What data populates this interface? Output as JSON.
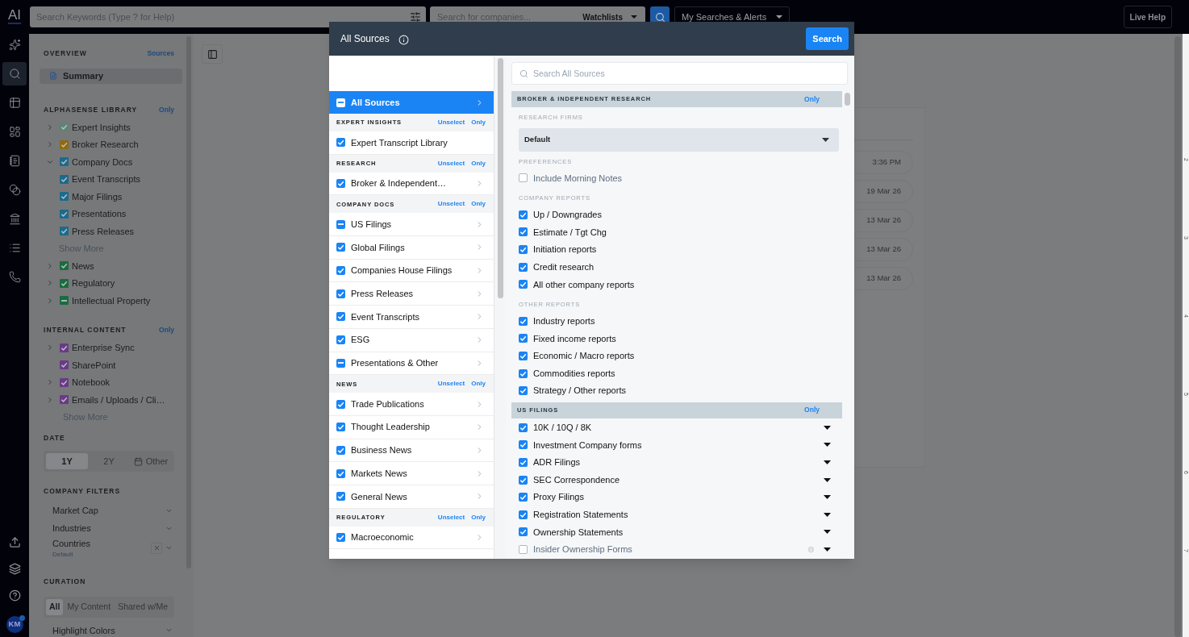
{
  "rail": {
    "logo": "AI",
    "items": [
      {
        "selected": false
      },
      {
        "selected": true
      },
      {
        "selected": false
      },
      {
        "selected": false
      },
      {
        "selected": false
      },
      {
        "selected": false
      },
      {
        "selected": false
      },
      {
        "selected": false
      },
      {
        "selected": false
      }
    ],
    "avatar": {
      "initials": "KM",
      "notification": true
    }
  },
  "top_bar": {
    "keyword_search": {
      "placeholder": "Search Keywords (Type ? for Help)"
    },
    "company_search": {
      "placeholder": "Search for companies..."
    },
    "watchlists": "Watchlists",
    "saved_searches": "My Searches & Alerts",
    "live_help": "Live Help"
  },
  "sidebar": {
    "overview": {
      "title": "OVERVIEW",
      "link": "Sources",
      "items": [
        {
          "label": "Summary",
          "selected": true
        }
      ]
    },
    "sections": [
      {
        "title": "ALPHASENSE LIBRARY",
        "action": "Only",
        "items": [
          {
            "label": "Expert Insights",
            "color": "#5f8273",
            "checked": true,
            "expanded": false
          },
          {
            "label": "Broker Research",
            "color": "#8c6b12",
            "checked": true,
            "expanded": false
          },
          {
            "label": "Company Docs",
            "color": "#1c6a8c",
            "checked": true,
            "expanded": true,
            "children": [
              {
                "label": "Event Transcripts",
                "color": "#1c6a8c",
                "checked": true
              },
              {
                "label": "Major Filings",
                "color": "#1c6a8c",
                "checked": true
              },
              {
                "label": "Presentations",
                "color": "#1c6a8c",
                "checked": true
              },
              {
                "label": "Press Releases",
                "color": "#1c6a8c",
                "checked": true
              }
            ],
            "show_more": "Show More"
          },
          {
            "label": "News",
            "color": "#1b6b3e",
            "checked": true,
            "expanded": false
          },
          {
            "label": "Regulatory",
            "color": "#1b6b3e",
            "checked": true,
            "expanded": false
          },
          {
            "label": "Intellectual Property",
            "color": "#1b6b3e",
            "checked": true,
            "partial": true,
            "expanded": false
          }
        ]
      },
      {
        "title": "INTERNAL CONTENT",
        "action": "Only",
        "items": [
          {
            "label": "Enterprise Sync",
            "color": "#6a3a88",
            "checked": true,
            "expanded": false
          },
          {
            "label": "SharePoint",
            "color": "#6a3a88",
            "checked": true
          },
          {
            "label": "Notebook",
            "color": "#6a3a88",
            "checked": true,
            "expanded": false
          },
          {
            "label": "Emails / Uploads / Cli…",
            "color": "#6a3a88",
            "checked": true,
            "expanded": false
          }
        ],
        "show_more": "Show More"
      }
    ],
    "date": {
      "title": "DATE",
      "options": [
        {
          "label": "1Y",
          "selected": true,
          "kind": "plain"
        },
        {
          "label": "2Y",
          "selected": false,
          "kind": "plain"
        },
        {
          "label": "Other",
          "selected": false,
          "kind": "calendar"
        }
      ]
    },
    "company_filters": {
      "title": "COMPANY FILTERS",
      "items": [
        {
          "label": "Market Cap",
          "clearable": false
        },
        {
          "label": "Industries",
          "clearable": false
        },
        {
          "label": "Countries",
          "note": "Default",
          "clearable": true
        }
      ]
    },
    "curation": {
      "title": "CURATION",
      "tabs": [
        {
          "label": "All",
          "selected": true
        },
        {
          "label": "My Content",
          "selected": false
        },
        {
          "label": "Shared w/Me",
          "selected": false
        }
      ],
      "next_filter": "Highlight Colors"
    }
  },
  "main": {
    "dates": [
      "3:36 PM",
      "19 Mar 26",
      "13 Mar 26",
      "13 Mar 26",
      "13 Mar 26"
    ]
  },
  "ruler": [
    "2",
    "3",
    "4",
    "5",
    "6",
    "7"
  ],
  "modal": {
    "title": "All Sources",
    "search_button": "Search",
    "root": {
      "label": "All Sources",
      "checked": true,
      "partial": true,
      "selected": true
    },
    "groups": [
      {
        "title": "EXPERT INSIGHTS",
        "unselect": "Unselect",
        "only": "Only",
        "items": [
          {
            "label": "Expert Transcript Library",
            "checked": true,
            "arrow": false
          }
        ]
      },
      {
        "title": "RESEARCH",
        "unselect": "Unselect",
        "only": "Only",
        "items": [
          {
            "label": "Broker & Independent…",
            "checked": true,
            "arrow": true
          }
        ]
      },
      {
        "title": "COMPANY DOCS",
        "unselect": "Unselect",
        "only": "Only",
        "items": [
          {
            "label": "US Filings",
            "checked": true,
            "partial": true,
            "arrow": true
          },
          {
            "label": "Global Filings",
            "checked": true,
            "arrow": true
          },
          {
            "label": "Companies House Filings",
            "checked": true,
            "arrow": true
          },
          {
            "label": "Press Releases",
            "checked": true,
            "arrow": true
          },
          {
            "label": "Event Transcripts",
            "checked": true,
            "arrow": true
          },
          {
            "label": "ESG",
            "checked": true,
            "arrow": true
          },
          {
            "label": "Presentations & Other",
            "checked": true,
            "partial": true,
            "arrow": true
          }
        ]
      },
      {
        "title": "NEWS",
        "unselect": "Unselect",
        "only": "Only",
        "items": [
          {
            "label": "Trade Publications",
            "checked": true,
            "arrow": true
          },
          {
            "label": "Thought Leadership",
            "checked": true,
            "arrow": true
          },
          {
            "label": "Business News",
            "checked": true,
            "arrow": true
          },
          {
            "label": "Markets News",
            "checked": true,
            "arrow": true
          },
          {
            "label": "General News",
            "checked": true,
            "arrow": true
          }
        ]
      },
      {
        "title": "REGULATORY",
        "unselect": "Unselect",
        "only": "Only",
        "items": [
          {
            "label": "Macroeconomic",
            "checked": true,
            "arrow": true
          }
        ]
      }
    ],
    "search": {
      "placeholder": "Search All Sources"
    },
    "sections": [
      {
        "title": "BROKER & INDEPENDENT RESEARCH",
        "action": "Only",
        "blocks": [
          {
            "kind": "select",
            "title": "RESEARCH FIRMS",
            "value": "Default"
          },
          {
            "kind": "checks",
            "title": "PREFERENCES",
            "items": [
              {
                "label": "Include Morning Notes",
                "checked": false
              }
            ]
          },
          {
            "kind": "checks",
            "title": "COMPANY REPORTS",
            "items": [
              {
                "label": "Up / Downgrades",
                "checked": true
              },
              {
                "label": "Estimate / Tgt Chg",
                "checked": true
              },
              {
                "label": "Initiation reports",
                "checked": true
              },
              {
                "label": "Credit research",
                "checked": true
              },
              {
                "label": "All other company reports",
                "checked": true
              }
            ]
          },
          {
            "kind": "checks",
            "title": "OTHER REPORTS",
            "items": [
              {
                "label": "Industry reports",
                "checked": true
              },
              {
                "label": "Fixed income reports",
                "checked": true
              },
              {
                "label": "Economic / Macro reports",
                "checked": true
              },
              {
                "label": "Commodities reports",
                "checked": true
              },
              {
                "label": "Strategy / Other reports",
                "checked": true
              }
            ]
          }
        ]
      },
      {
        "title": "US FILINGS",
        "action": "Only",
        "blocks": [
          {
            "kind": "checks",
            "items": [
              {
                "label": "10K / 10Q / 8K",
                "checked": true,
                "menu": true
              },
              {
                "label": "Investment Company forms",
                "checked": true,
                "menu": true
              },
              {
                "label": "ADR Filings",
                "checked": true,
                "menu": true
              },
              {
                "label": "SEC Correspondence",
                "checked": true,
                "menu": true
              },
              {
                "label": "Proxy Filings",
                "checked": true,
                "menu": true
              },
              {
                "label": "Registration Statements",
                "checked": true,
                "menu": true
              },
              {
                "label": "Ownership Statements",
                "checked": true,
                "menu": true
              },
              {
                "label": "Insider Ownership Forms",
                "checked": false,
                "menu": true,
                "info": true
              }
            ]
          }
        ]
      }
    ]
  }
}
